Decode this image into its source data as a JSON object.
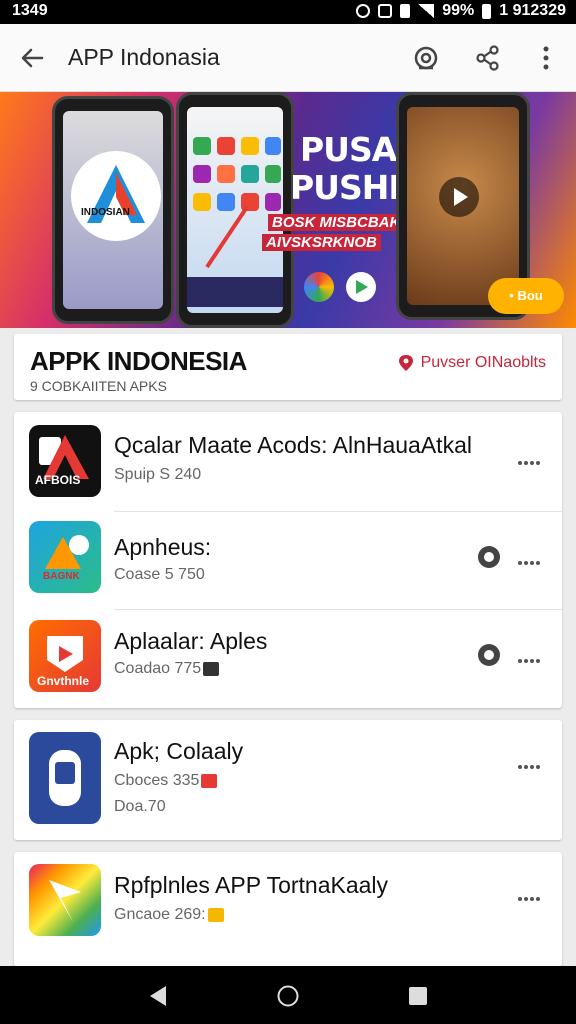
{
  "status": {
    "time": "1349",
    "battery": "99%",
    "right_text": "1 912329"
  },
  "appbar": {
    "title": "APP Indonasia"
  },
  "banner": {
    "logo_text": "INDOSIAN",
    "headline_1": "PUSAK",
    "headline_2": "PUSHI",
    "sub_1": "BOSK MISBCBAKSB",
    "sub_2": "AIVSKSRKNOB",
    "badge": "• Bou"
  },
  "header": {
    "title": "APPK INDONESIA",
    "subtitle": "9 COBKAIITEN APKS",
    "link": "Puvser OINaoblts"
  },
  "apps": [
    {
      "name": "Qcalar Maate Acods: AlnHauaAtkal",
      "sub": "Spuip S 240",
      "icon_text": "AFBOIS",
      "has_pin": false
    },
    {
      "name": "Apnheus:",
      "sub": "Coase 5 750",
      "icon_text": "BAGNK",
      "has_pin": true
    },
    {
      "name": "Aplaalar: Aples",
      "sub": "Coadao 775",
      "icon_text": "Gnvthnle",
      "has_pin": true
    },
    {
      "name": "Apk; Colaaly",
      "sub": "Cboces 335",
      "sub2": "Doa.70",
      "has_pin": false
    },
    {
      "name": "Rpfplnles APP TortnaKaaly",
      "sub": "Gncaoe 269:",
      "has_pin": false
    }
  ],
  "colors": {
    "accent": "#c8243a",
    "banner_badge": "#ffb300"
  }
}
